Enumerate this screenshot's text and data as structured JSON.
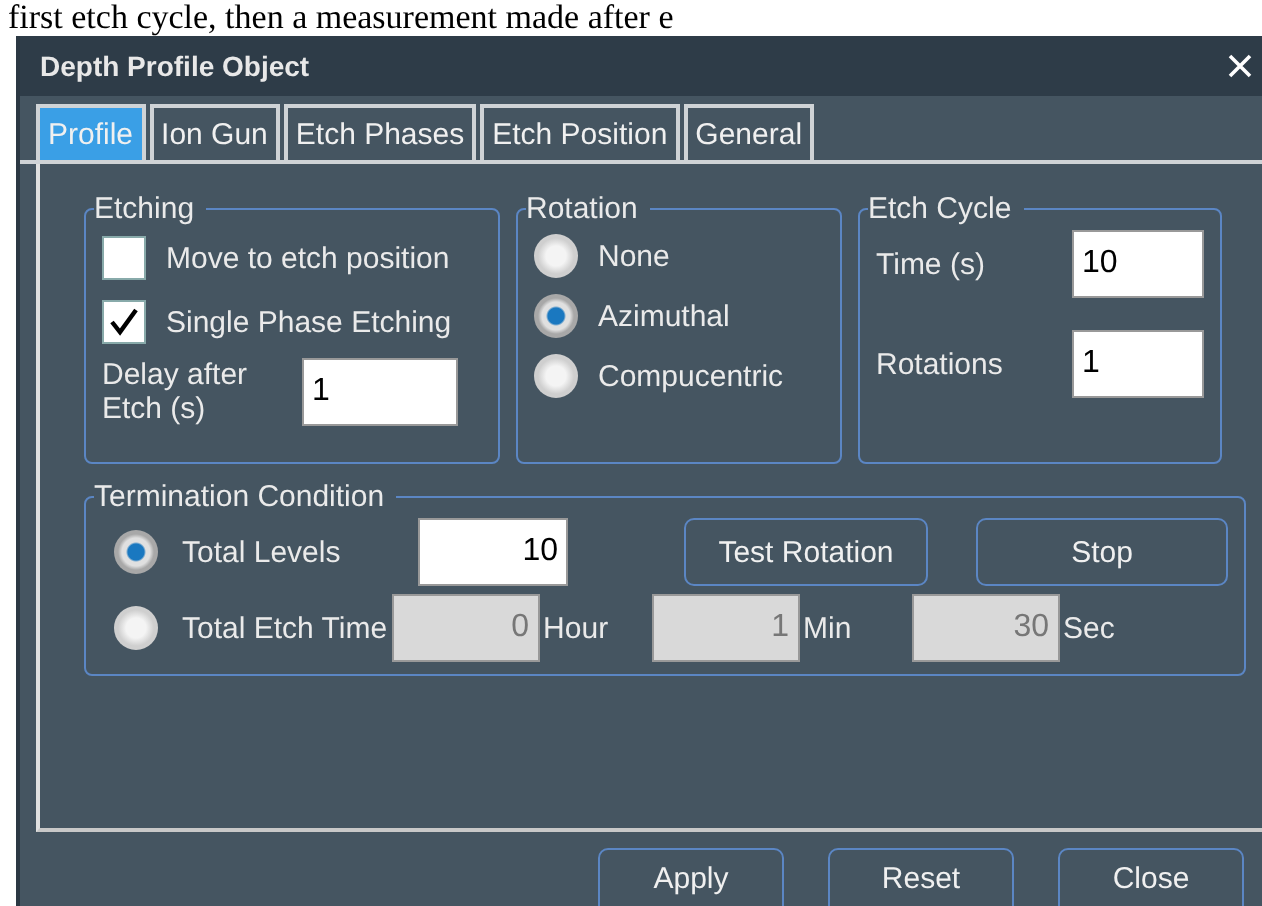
{
  "background_text": "first etch cycle, then a measurement made after e",
  "window": {
    "title": "Depth Profile Object"
  },
  "tabs": [
    {
      "label": "Profile",
      "selected": true
    },
    {
      "label": "Ion Gun",
      "selected": false
    },
    {
      "label": "Etch Phases",
      "selected": false
    },
    {
      "label": "Etch Position",
      "selected": false
    },
    {
      "label": "General",
      "selected": false
    }
  ],
  "etching": {
    "title": "Etching",
    "checkboxes": [
      {
        "label": "Move to etch position",
        "checked": false
      },
      {
        "label": "Single Phase Etching",
        "checked": true
      }
    ],
    "delay": {
      "label": "Delay after Etch (s)",
      "value": "1"
    }
  },
  "rotation": {
    "title": "Rotation",
    "options": [
      {
        "label": "None",
        "selected": false
      },
      {
        "label": "Azimuthal",
        "selected": true
      },
      {
        "label": "Compucentric",
        "selected": false
      }
    ]
  },
  "etch_cycle": {
    "title": "Etch Cycle",
    "fields": [
      {
        "label": "Time (s)",
        "value": "10"
      },
      {
        "label": "Rotations",
        "value": "1"
      }
    ]
  },
  "termination": {
    "title": "Termination Condition",
    "options": [
      {
        "kind": "levels",
        "label": "Total Levels",
        "selected": true,
        "fields": [
          {
            "value": "10",
            "disabled": false
          }
        ]
      },
      {
        "kind": "time",
        "label": "Total Etch Time",
        "selected": false,
        "fields": [
          {
            "value": "0",
            "unit": "Hour",
            "disabled": true
          },
          {
            "value": "1",
            "unit": "Min",
            "disabled": true
          },
          {
            "value": "30",
            "unit": "Sec",
            "disabled": true
          }
        ]
      }
    ],
    "buttons": [
      "Test Rotation",
      "Stop"
    ]
  },
  "buttons": [
    "Apply",
    "Reset",
    "Close"
  ]
}
